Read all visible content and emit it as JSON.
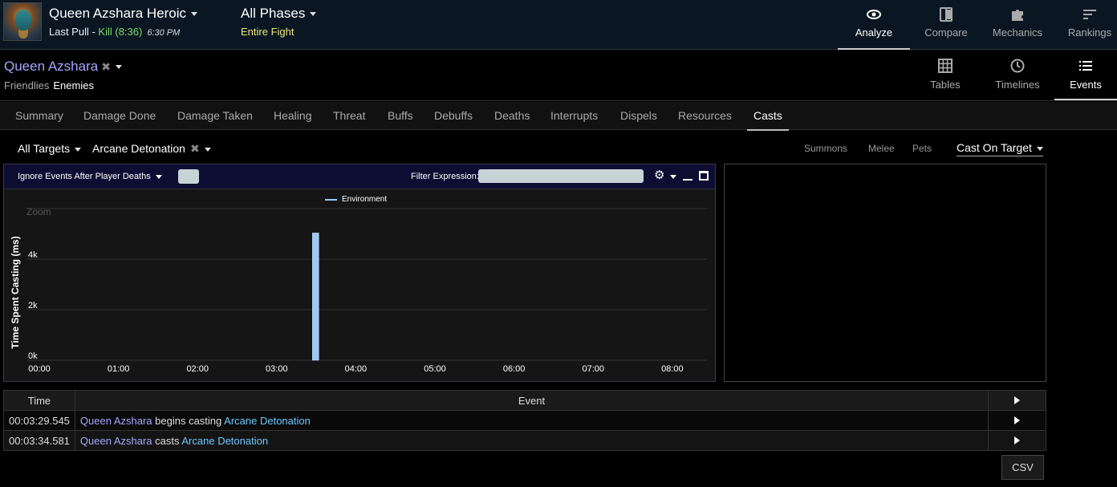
{
  "header": {
    "encounter_title": "Queen Azshara Heroic",
    "last_pull_label": "Last Pull - ",
    "kill_text": "Kill (8:36)",
    "pull_time": "6:30 PM",
    "phase_title": "All Phases",
    "phase_sub": "Entire Fight",
    "nav": [
      {
        "label": "Analyze",
        "icon": "eye-icon"
      },
      {
        "label": "Compare",
        "icon": "compare-icon"
      },
      {
        "label": "Mechanics",
        "icon": "puzzle-icon"
      },
      {
        "label": "Rankings",
        "icon": "rankings-icon"
      }
    ]
  },
  "actor_bar": {
    "actor_name": "Queen Azshara",
    "remove_mark": "✖",
    "friendlies": "Friendlies",
    "enemies": "Enemies",
    "views": [
      {
        "label": "Tables",
        "icon": "grid-icon"
      },
      {
        "label": "Timelines",
        "icon": "clock-icon"
      },
      {
        "label": "Events",
        "icon": "list-icon"
      }
    ]
  },
  "tabs": [
    "Summary",
    "Damage Done",
    "Damage Taken",
    "Healing",
    "Threat",
    "Buffs",
    "Debuffs",
    "Deaths",
    "Interrupts",
    "Dispels",
    "Resources",
    "Casts"
  ],
  "active_tab": "Casts",
  "filters": {
    "targets": "All Targets",
    "ability": "Arcane Detonation",
    "remove_mark": "✖",
    "options": [
      "Summons",
      "Melee",
      "Pets"
    ],
    "cast_mode": "Cast On Target"
  },
  "chart_toolbar": {
    "ignore_label": "Ignore Events After Player Deaths",
    "filter_label": "Filter Expression:",
    "filter_value": ""
  },
  "chart_data": {
    "type": "bar",
    "zoom_label": "Zoom",
    "ylabel": "Time Spent Casting (ms)",
    "ylim": [
      0,
      6000
    ],
    "yticks": [
      "0k",
      "2k",
      "4k"
    ],
    "ytick_values": [
      0,
      2000,
      4000
    ],
    "xticks": [
      "00:00",
      "01:00",
      "02:00",
      "03:00",
      "04:00",
      "05:00",
      "06:00",
      "07:00",
      "08:00"
    ],
    "xtick_seconds": [
      0,
      60,
      120,
      180,
      240,
      300,
      360,
      420,
      480
    ],
    "xlim_seconds": [
      0,
      516
    ],
    "series": [
      {
        "name": "Environment",
        "color": "#9cc9f5",
        "points": [
          {
            "x": "03:29",
            "x_seconds": 209.5,
            "y": 5036
          }
        ]
      }
    ]
  },
  "events_table": {
    "columns": [
      "Time",
      "Event"
    ],
    "rows": [
      {
        "time": "00:03:29.545",
        "source": "Queen Azshara",
        "action": " begins casting ",
        "ability": "Arcane Detonation"
      },
      {
        "time": "00:03:34.581",
        "source": "Queen Azshara",
        "action": " casts ",
        "ability": "Arcane Detonation"
      }
    ]
  },
  "csv_label": "CSV"
}
